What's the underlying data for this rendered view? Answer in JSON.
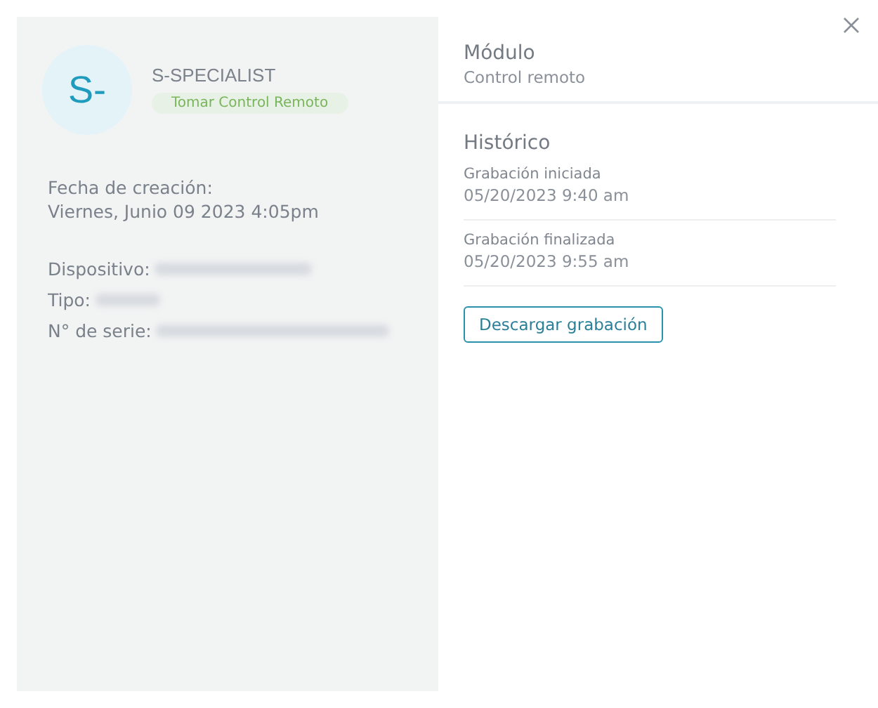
{
  "profile": {
    "avatar_initials": "S-",
    "name": "S-SPECIALIST",
    "tag": "Tomar Control Remoto"
  },
  "creation": {
    "label": "Fecha de creación:",
    "value": "Viernes, Junio 09 2023 4:05pm"
  },
  "details": [
    {
      "label": "Dispositivo:",
      "redacted": true
    },
    {
      "label": "Tipo:",
      "redacted": true
    },
    {
      "label": "N° de serie:",
      "redacted": true
    }
  ],
  "module": {
    "title": "Módulo",
    "value": "Control remoto"
  },
  "history": {
    "title": "Histórico",
    "entries": [
      {
        "label": "Grabación iniciada",
        "time": "05/20/2023 9:40 am"
      },
      {
        "label": "Grabación finalizada",
        "time": "05/20/2023 9:55 am"
      }
    ]
  },
  "download_button": "Descargar grabación"
}
